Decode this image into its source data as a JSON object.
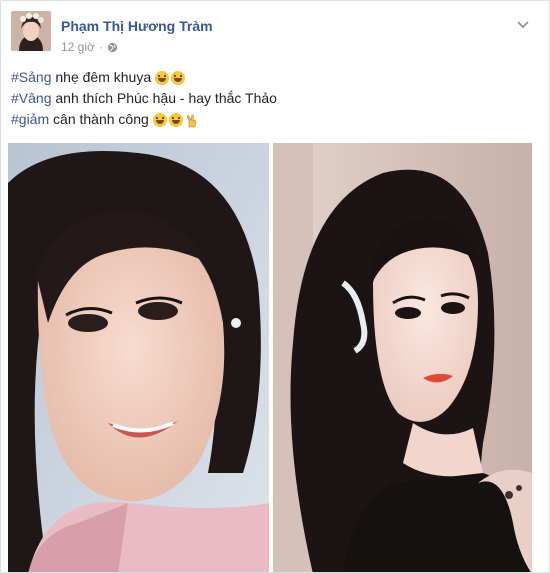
{
  "post": {
    "author": "Phạm Thị Hương Tràm",
    "time": "12 giờ",
    "privacy_icon": "globe-icon",
    "menu_icon": "chevron-down-icon",
    "lines": [
      {
        "hashtag": "#Sảng",
        "text": " nhẹ đêm khuya",
        "emojis": [
          "rofl-emoji",
          "rofl-emoji"
        ]
      },
      {
        "hashtag": "#Vâng",
        "text": " anh thích Phúc hậu - hay thắc Thảo",
        "emojis": []
      },
      {
        "hashtag": "#giảm",
        "text": " cân thành công",
        "emojis": [
          "rofl-emoji",
          "rofl-emoji",
          "victory-hand-emoji"
        ]
      }
    ],
    "photos": [
      "smiling-woman-photo",
      "woman-with-curly-hair-photo"
    ]
  },
  "colors": {
    "name_link": "#365899",
    "body_text": "#1d2129",
    "meta_text": "#90949c",
    "background": "#e9ebee"
  }
}
